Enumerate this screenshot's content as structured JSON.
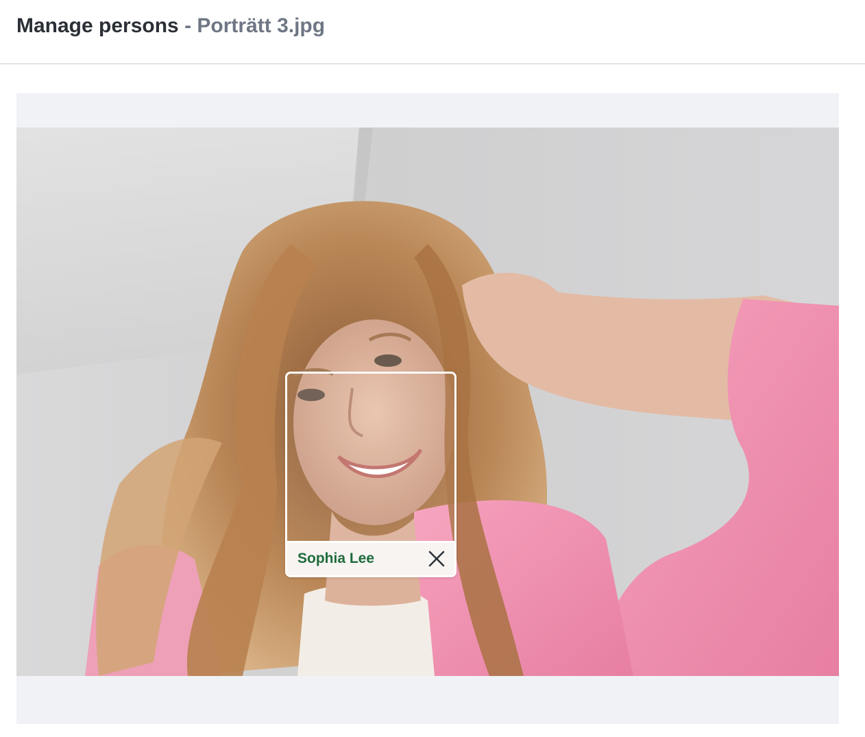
{
  "header": {
    "title": "Manage persons",
    "separator": " - ",
    "filename": "Porträtt 3.jpg"
  },
  "photo": {
    "subject": "portrait-photo"
  },
  "faces": [
    {
      "name": "Sophia Lee",
      "remove_icon": "close-icon"
    }
  ],
  "colors": {
    "name_text": "#1e6b3a",
    "stage_bg": "#f0f2f5",
    "title_text": "#2b2f36",
    "filename_text": "#6f7785"
  }
}
